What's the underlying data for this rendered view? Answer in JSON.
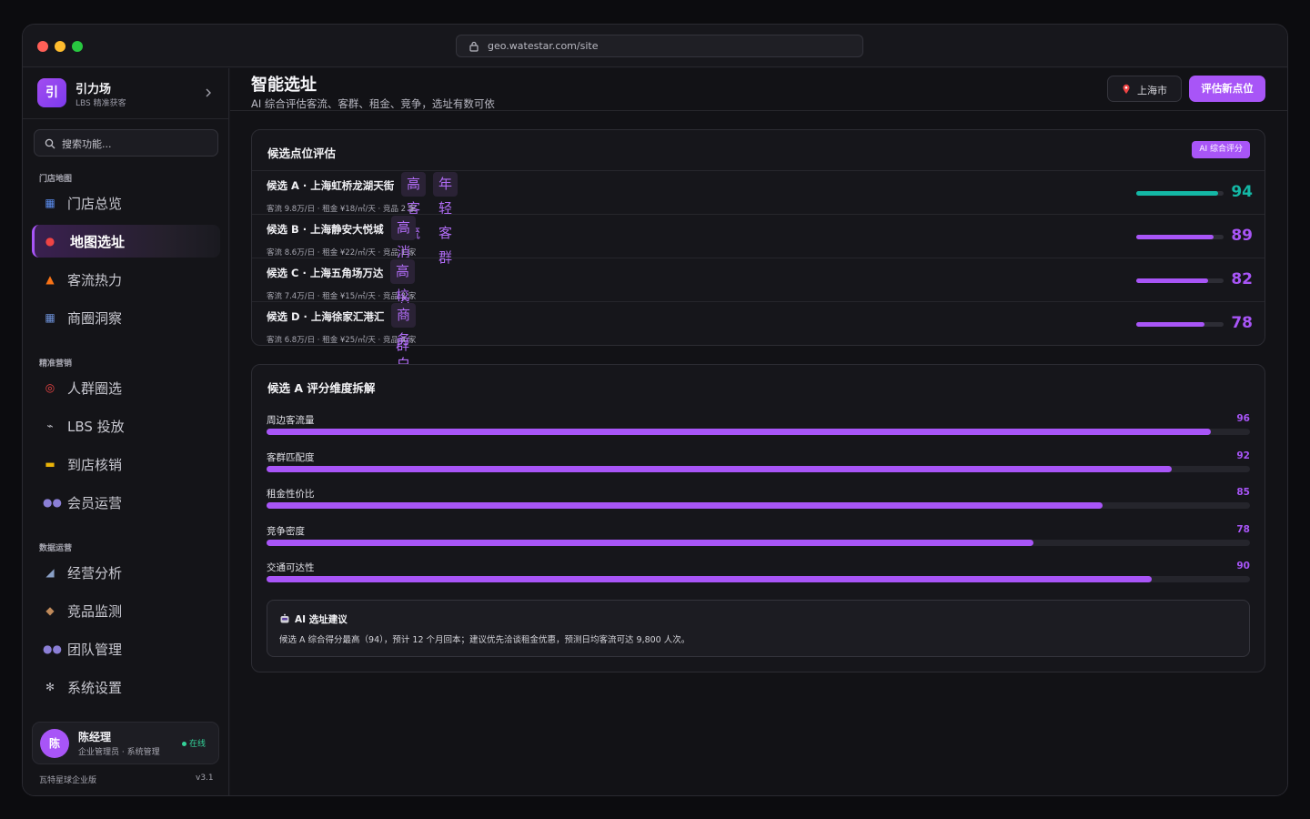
{
  "browser": {
    "url": "geo.watestar.com/site"
  },
  "brand": {
    "logo_text": "引",
    "name": "引力场",
    "subtitle": "LBS 精准获客"
  },
  "search": {
    "placeholder": "搜索功能..."
  },
  "sidebar": {
    "sections": [
      {
        "label": "门店地图",
        "items": [
          {
            "icon": "map-icon",
            "glyph": "▦",
            "color": "#5b8def",
            "label": "门店总览",
            "active": false
          },
          {
            "icon": "pin-icon",
            "glyph": "●",
            "color": "#ef4444",
            "label": "地图选址",
            "active": true
          },
          {
            "icon": "fire-icon",
            "glyph": "▲",
            "color": "#f97316",
            "label": "客流热力",
            "active": false
          },
          {
            "icon": "buildings-icon",
            "glyph": "▦",
            "color": "#6b8fd6",
            "label": "商圈洞察",
            "active": false
          }
        ]
      },
      {
        "label": "精准营销",
        "items": [
          {
            "icon": "target-icon",
            "glyph": "◎",
            "color": "#ef4444",
            "label": "人群圈选",
            "active": false
          },
          {
            "icon": "satellite-icon",
            "glyph": "⌁",
            "color": "#c0c0c8",
            "label": "LBS 投放",
            "active": false
          },
          {
            "icon": "ticket-icon",
            "glyph": "▬",
            "color": "#eab308",
            "label": "到店核销",
            "active": false
          },
          {
            "icon": "members-icon",
            "glyph": "●●",
            "color": "#8b7fd6",
            "label": "会员运营",
            "active": false
          }
        ]
      },
      {
        "label": "数据运营",
        "items": [
          {
            "icon": "chart-icon",
            "glyph": "◢",
            "color": "#8aa0c6",
            "label": "经营分析",
            "active": false
          },
          {
            "icon": "spy-icon",
            "glyph": "◆",
            "color": "#c08a5a",
            "label": "竞品监测",
            "active": false
          },
          {
            "icon": "team-icon",
            "glyph": "●●",
            "color": "#8b7fd6",
            "label": "团队管理",
            "active": false
          },
          {
            "icon": "gear-icon",
            "glyph": "✻",
            "color": "#b8b8c0",
            "label": "系统设置",
            "active": false
          }
        ]
      }
    ]
  },
  "user": {
    "avatar": "陈",
    "name": "陈经理",
    "role": "企业管理员 · 系统管理",
    "status": "在线"
  },
  "footer": {
    "edition": "瓦特星球企业版",
    "version": "v3.1"
  },
  "header": {
    "title": "智能选址",
    "subtitle": "AI 综合评估客流、客群、租金、竞争，选址有数可依",
    "city": "上海市",
    "primary_action": "评估新点位"
  },
  "candidates_card": {
    "title": "候选点位评估",
    "badge": "AI 综合评分",
    "items": [
      {
        "name": "候选 A · 上海虹桥龙湖天街",
        "tags": [
          "高客流",
          "年轻客群"
        ],
        "meta": "客流 9.8万/日 · 租金 ¥18/㎡/天 · 竞品 2 家",
        "score": 94,
        "color": "#14b8a6",
        "fill": 0.94
      },
      {
        "name": "候选 B · 上海静安大悦城",
        "tags": [
          "高消费力"
        ],
        "meta": "客流 8.6万/日 · 租金 ¥22/㎡/天 · 竞品 1 家",
        "score": 89,
        "color": "#a855f7",
        "fill": 0.89
      },
      {
        "name": "候选 C · 上海五角场万达",
        "tags": [
          "高校客群"
        ],
        "meta": "客流 7.4万/日 · 租金 ¥15/㎡/天 · 竞品 3 家",
        "score": 82,
        "color": "#a855f7",
        "fill": 0.82
      },
      {
        "name": "候选 D · 上海徐家汇港汇",
        "tags": [
          "商务白领"
        ],
        "meta": "客流 6.8万/日 · 租金 ¥25/㎡/天 · 竞品 4 家",
        "score": 78,
        "color": "#a855f7",
        "fill": 0.78
      }
    ]
  },
  "breakdown_card": {
    "title": "候选 A 评分维度拆解",
    "dimensions": [
      {
        "label": "周边客流量",
        "value": 96
      },
      {
        "label": "客群匹配度",
        "value": 92
      },
      {
        "label": "租金性价比",
        "value": 85
      },
      {
        "label": "竞争密度",
        "value": 78
      },
      {
        "label": "交通可达性",
        "value": 90
      }
    ],
    "advice": {
      "title": "AI 选址建议",
      "text": "候选 A 综合得分最高（94），预计 12 个月回本；建议优先洽谈租金优惠，预测日均客流可达 9,800 人次。"
    }
  }
}
